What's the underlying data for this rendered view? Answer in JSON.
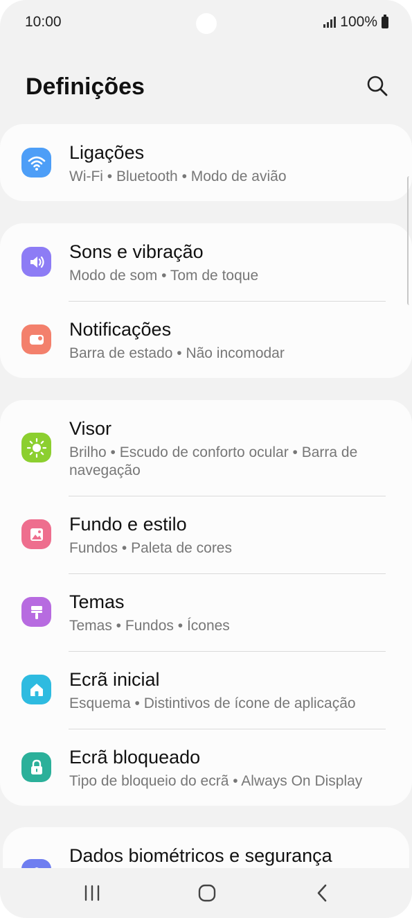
{
  "status_bar": {
    "time": "10:00",
    "battery": "100%"
  },
  "header": {
    "title": "Definições"
  },
  "settings": [
    {
      "title": "Ligações",
      "subtitle": "Wi-Fi  •  Bluetooth  •  Modo de avião",
      "icon": "wifi-icon",
      "color": "#4d9ef7"
    },
    {
      "title": "Sons e vibração",
      "subtitle": "Modo de som  •  Tom de toque",
      "icon": "volume-icon",
      "color": "#8d7cf5"
    },
    {
      "title": "Notificações",
      "subtitle": "Barra de estado  •  Não incomodar",
      "icon": "notification-icon",
      "color": "#f3806c"
    },
    {
      "title": "Visor",
      "subtitle": "Brilho  •  Escudo de conforto ocular  •  Barra de navegação",
      "icon": "sun-icon",
      "color": "#8ccf2f"
    },
    {
      "title": "Fundo e estilo",
      "subtitle": "Fundos  •  Paleta de cores",
      "icon": "wallpaper-icon",
      "color": "#ee6e8e"
    },
    {
      "title": "Temas",
      "subtitle": "Temas  •  Fundos  •  Ícones",
      "icon": "paintbrush-icon",
      "color": "#b76be0"
    },
    {
      "title": "Ecrã inicial",
      "subtitle": "Esquema  •  Distintivos de ícone de aplicação",
      "icon": "home-icon",
      "color": "#2ebbe0"
    },
    {
      "title": "Ecrã bloqueado",
      "subtitle": "Tipo de bloqueio do ecrã  •  Always On Display",
      "icon": "lock-icon",
      "color": "#2bb09a"
    },
    {
      "title": "Dados biométricos e segurança",
      "subtitle": "",
      "icon": "shield-icon",
      "color": "#6f7ef0"
    }
  ],
  "nav_bar": {
    "buttons": [
      "recent-apps",
      "home",
      "back"
    ]
  }
}
